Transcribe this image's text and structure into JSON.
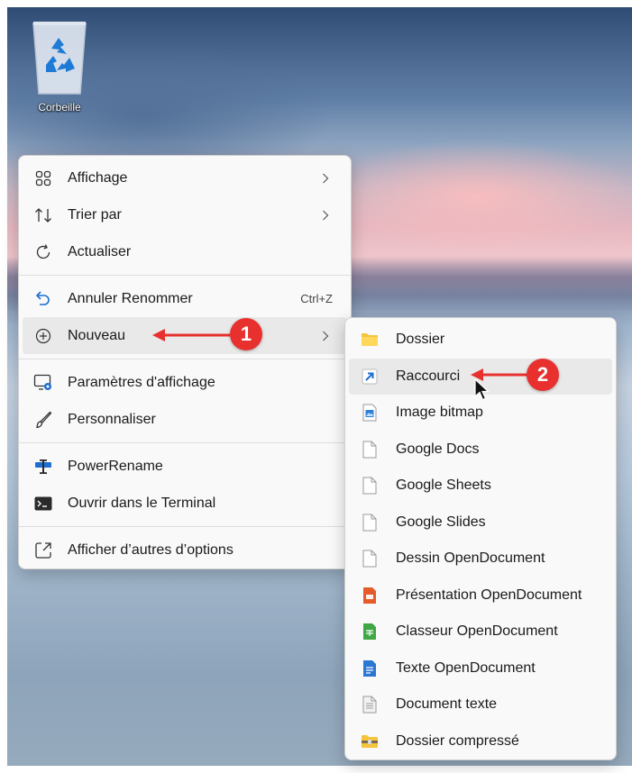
{
  "desktop": {
    "recycle_bin_label": "Corbeille"
  },
  "context_menu": {
    "items": [
      {
        "label": "Affichage",
        "icon": "grid-icon",
        "submenu": true
      },
      {
        "label": "Trier par",
        "icon": "sort-icon",
        "submenu": true
      },
      {
        "label": "Actualiser",
        "icon": "refresh-icon"
      },
      {
        "label": "Annuler Renommer",
        "icon": "undo-icon",
        "shortcut": "Ctrl+Z"
      },
      {
        "label": "Nouveau",
        "icon": "add-circle-icon",
        "submenu": true
      },
      {
        "label": "Paramètres d'affichage",
        "icon": "display-settings-icon"
      },
      {
        "label": "Personnaliser",
        "icon": "brush-icon"
      },
      {
        "label": "PowerRename",
        "icon": "powerrename-icon"
      },
      {
        "label": "Ouvrir dans le Terminal",
        "icon": "terminal-icon"
      },
      {
        "label": "Afficher d’autres d’options",
        "icon": "more-options-icon"
      }
    ]
  },
  "new_submenu": {
    "items": [
      {
        "label": "Dossier",
        "icon": "folder-icon"
      },
      {
        "label": "Raccourci",
        "icon": "shortcut-icon"
      },
      {
        "label": "Image bitmap",
        "icon": "bitmap-icon"
      },
      {
        "label": "Google Docs",
        "icon": "blank-file-icon"
      },
      {
        "label": "Google Sheets",
        "icon": "blank-file-icon"
      },
      {
        "label": "Google Slides",
        "icon": "blank-file-icon"
      },
      {
        "label": "Dessin OpenDocument",
        "icon": "blank-file-icon"
      },
      {
        "label": "Présentation OpenDocument",
        "icon": "odp-icon"
      },
      {
        "label": "Classeur OpenDocument",
        "icon": "ods-icon"
      },
      {
        "label": "Texte OpenDocument",
        "icon": "odt-icon"
      },
      {
        "label": "Document texte",
        "icon": "text-file-icon"
      },
      {
        "label": "Dossier compressé",
        "icon": "zip-folder-icon"
      }
    ]
  },
  "annotations": {
    "step1": "1",
    "step2": "2",
    "color": "#e8312f"
  },
  "colors": {
    "menu_bg": "#f9f9f9",
    "highlight": "#e9e9e9",
    "accent_blue": "#0067c0"
  }
}
